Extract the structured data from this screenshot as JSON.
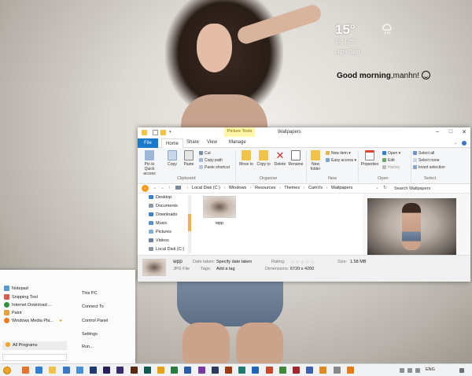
{
  "weather": {
    "temperature": "15°",
    "range": "31° | 25°",
    "condition": "Light Rain",
    "icon": "rain-cloud-icon"
  },
  "greeting": {
    "text": "Good morning",
    "name": ",manhn!",
    "icon": "smiley-icon"
  },
  "explorer": {
    "title": "Wallpapers",
    "context_tab": "Picture Tools",
    "tabs": {
      "file": "File",
      "home": "Home",
      "share": "Share",
      "view": "View",
      "manage": "Manage"
    },
    "ribbon": {
      "clipboard": {
        "label": "Clipboard",
        "pin": "Pin to Quick access",
        "copy": "Copy",
        "paste": "Paste",
        "cut": "Cut",
        "copy_path": "Copy path",
        "paste_shortcut": "Paste shortcut"
      },
      "organise": {
        "label": "Organise",
        "move_to": "Move to",
        "copy_to": "Copy to",
        "delete": "Delete",
        "rename": "Rename"
      },
      "new": {
        "label": "New",
        "new_folder": "New folder",
        "new_item": "New item",
        "easy_access": "Easy access"
      },
      "open": {
        "label": "Open",
        "properties": "Properties",
        "open": "Open",
        "edit": "Edit",
        "history": "History"
      },
      "select": {
        "label": "Select",
        "select_all": "Select all",
        "select_none": "Select none",
        "invert": "Invert selection"
      }
    },
    "breadcrumbs": [
      "Local Disk (C:)",
      "Windows",
      "Resources",
      "Themes",
      "CamVs",
      "Wallpapers"
    ],
    "search_placeholder": "Search Wallpapers",
    "nav_items": [
      "Desktop",
      "Documents",
      "Downloads",
      "Music",
      "Pictures",
      "Videos",
      "Local Disk (C:)"
    ],
    "files": [
      {
        "name": "wpp"
      }
    ],
    "details": {
      "name": "wpp",
      "type": "JPG File",
      "date_label": "Date taken:",
      "date_value": "Specify date taken",
      "tags_label": "Tags:",
      "tags_value": "Add a tag",
      "rating_label": "Rating:",
      "rating_stars": "☆☆☆☆☆",
      "dimensions_label": "Dimensions:",
      "dimensions_value": "6720 x 4200",
      "size_label": "Size:",
      "size_value": "1.58 MB"
    }
  },
  "start_menu": {
    "programs": [
      {
        "label": "Notepad",
        "color": "#5b9bd5"
      },
      {
        "label": "Snipping Tool",
        "color": "#e05a4f"
      },
      {
        "label": "Internet Download ...",
        "color": "#2f8f3a"
      },
      {
        "label": "Paint",
        "color": "#e9a23b"
      },
      {
        "label": "Windows Media Pla...",
        "color": "#f07c1f"
      }
    ],
    "all_programs": "All Programs",
    "right_items": [
      "This PC",
      "Connect To",
      "Control Panel",
      "Settings",
      "Run..."
    ]
  },
  "taskbar": {
    "language": "ENG",
    "apps": [
      {
        "icon": "firefox-icon",
        "color": "#e8752e"
      },
      {
        "icon": "edge-icon",
        "color": "#2f7fd8"
      },
      {
        "icon": "file-explorer-icon",
        "color": "#f2c34b"
      },
      {
        "icon": "mail-icon",
        "color": "#3b78c4"
      },
      {
        "icon": "store-icon",
        "color": "#4a8fd6"
      },
      {
        "icon": "photoshop-icon",
        "color": "#1f3a6e"
      },
      {
        "icon": "premiere-icon",
        "color": "#2b1e5a"
      },
      {
        "icon": "after-effects-icon",
        "color": "#3c2a6e"
      },
      {
        "icon": "illustrator-icon",
        "color": "#5a2a10"
      },
      {
        "icon": "audition-icon",
        "color": "#0e5a4e"
      },
      {
        "icon": "chrome-icon",
        "color": "#e3a21a"
      },
      {
        "icon": "excel-icon",
        "color": "#2b7a3e"
      },
      {
        "icon": "word-icon",
        "color": "#2b5aa8"
      },
      {
        "icon": "onenote-icon",
        "color": "#7b3aa3"
      },
      {
        "icon": "lightroom-icon",
        "color": "#2a3a5e"
      },
      {
        "icon": "animate-icon",
        "color": "#9e3a12"
      },
      {
        "icon": "publisher-icon",
        "color": "#1e7a6e"
      },
      {
        "icon": "outlook-icon",
        "color": "#2066b8"
      },
      {
        "icon": "powerpoint-icon",
        "color": "#c8462a"
      },
      {
        "icon": "project-icon",
        "color": "#3e8a3a"
      },
      {
        "icon": "access-icon",
        "color": "#a4262c"
      },
      {
        "icon": "visio-icon",
        "color": "#3c5fb0"
      },
      {
        "icon": "media-player-icon",
        "color": "#e08a1e"
      },
      {
        "icon": "settings-icon",
        "color": "#888888"
      },
      {
        "icon": "vlc-icon",
        "color": "#e67b15"
      }
    ]
  }
}
